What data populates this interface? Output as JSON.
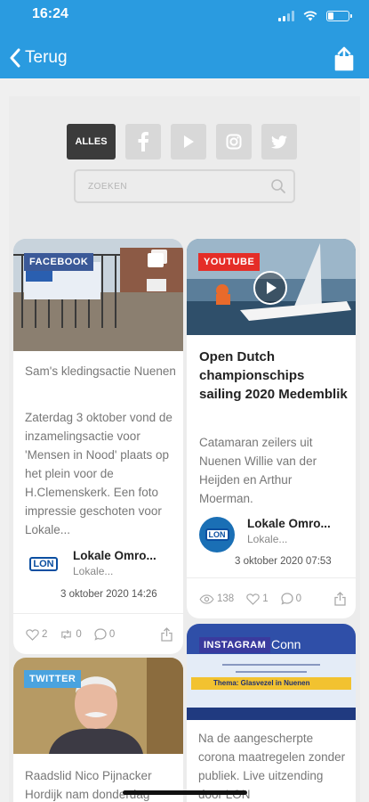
{
  "status": {
    "time": "16:24"
  },
  "header": {
    "back_label": "Terug"
  },
  "filters": {
    "all_label": "ALLES",
    "icons": [
      "facebook-icon",
      "youtube-icon",
      "instagram-icon",
      "twitter-icon"
    ]
  },
  "search": {
    "placeholder": "ZOEKEN"
  },
  "colors": {
    "accent": "#2a9be0",
    "facebook": "#3b5998",
    "youtube": "#e52d27",
    "twitter": "#4aa3df"
  },
  "cards": [
    {
      "badge": "FACEBOOK",
      "title": "Sam's kledingsactie Nuenen",
      "text": "Zaterdag 3 oktober vond de inzamelingsactie voor 'Mensen in Nood' plaats op het plein voor de H.Clemenskerk. Een foto impressie geschoten voor Lokale...",
      "author": "Lokale Omro...",
      "author_sub": "Lokale...",
      "date": "3 oktober 2020 14:26",
      "likes": "2",
      "retweets": "0",
      "comments": "0"
    },
    {
      "badge": "YOUTUBE",
      "title": "Open Dutch championschips sailing 2020 Medemblik",
      "text": "Catamaran zeilers uit Nuenen Willie van der Heijden en Arthur Moerman.",
      "author": "Lokale Omro...",
      "author_sub": "Lokale...",
      "date": "3 oktober 2020 07:53",
      "views": "138",
      "likes": "1",
      "comments": "0"
    },
    {
      "badge": "TWITTER",
      "text": "Raadslid Nico Pijnacker Hordijk nam donderdag"
    },
    {
      "badge": "INSTAGRAM",
      "image_heading": "Conn",
      "image_caption": "Thema: Glasvezel in Nuenen",
      "text": "Na de aangescherpte corona maatregelen zonder publiek. Live uitzending door LON"
    }
  ]
}
